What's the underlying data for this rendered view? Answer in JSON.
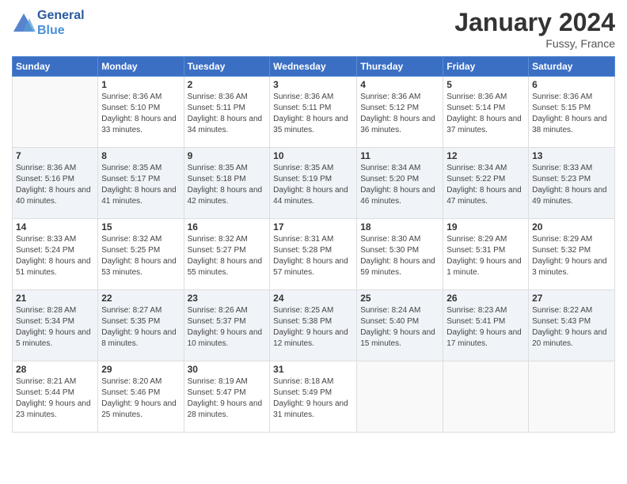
{
  "header": {
    "logo_line1": "General",
    "logo_line2": "Blue",
    "title": "January 2024",
    "location": "Fussy, France"
  },
  "columns": [
    "Sunday",
    "Monday",
    "Tuesday",
    "Wednesday",
    "Thursday",
    "Friday",
    "Saturday"
  ],
  "weeks": [
    [
      {
        "day": "",
        "sunrise": "",
        "sunset": "",
        "daylight": ""
      },
      {
        "day": "1",
        "sunrise": "Sunrise: 8:36 AM",
        "sunset": "Sunset: 5:10 PM",
        "daylight": "Daylight: 8 hours and 33 minutes."
      },
      {
        "day": "2",
        "sunrise": "Sunrise: 8:36 AM",
        "sunset": "Sunset: 5:11 PM",
        "daylight": "Daylight: 8 hours and 34 minutes."
      },
      {
        "day": "3",
        "sunrise": "Sunrise: 8:36 AM",
        "sunset": "Sunset: 5:11 PM",
        "daylight": "Daylight: 8 hours and 35 minutes."
      },
      {
        "day": "4",
        "sunrise": "Sunrise: 8:36 AM",
        "sunset": "Sunset: 5:12 PM",
        "daylight": "Daylight: 8 hours and 36 minutes."
      },
      {
        "day": "5",
        "sunrise": "Sunrise: 8:36 AM",
        "sunset": "Sunset: 5:14 PM",
        "daylight": "Daylight: 8 hours and 37 minutes."
      },
      {
        "day": "6",
        "sunrise": "Sunrise: 8:36 AM",
        "sunset": "Sunset: 5:15 PM",
        "daylight": "Daylight: 8 hours and 38 minutes."
      }
    ],
    [
      {
        "day": "7",
        "sunrise": "Sunrise: 8:36 AM",
        "sunset": "Sunset: 5:16 PM",
        "daylight": "Daylight: 8 hours and 40 minutes."
      },
      {
        "day": "8",
        "sunrise": "Sunrise: 8:35 AM",
        "sunset": "Sunset: 5:17 PM",
        "daylight": "Daylight: 8 hours and 41 minutes."
      },
      {
        "day": "9",
        "sunrise": "Sunrise: 8:35 AM",
        "sunset": "Sunset: 5:18 PM",
        "daylight": "Daylight: 8 hours and 42 minutes."
      },
      {
        "day": "10",
        "sunrise": "Sunrise: 8:35 AM",
        "sunset": "Sunset: 5:19 PM",
        "daylight": "Daylight: 8 hours and 44 minutes."
      },
      {
        "day": "11",
        "sunrise": "Sunrise: 8:34 AM",
        "sunset": "Sunset: 5:20 PM",
        "daylight": "Daylight: 8 hours and 46 minutes."
      },
      {
        "day": "12",
        "sunrise": "Sunrise: 8:34 AM",
        "sunset": "Sunset: 5:22 PM",
        "daylight": "Daylight: 8 hours and 47 minutes."
      },
      {
        "day": "13",
        "sunrise": "Sunrise: 8:33 AM",
        "sunset": "Sunset: 5:23 PM",
        "daylight": "Daylight: 8 hours and 49 minutes."
      }
    ],
    [
      {
        "day": "14",
        "sunrise": "Sunrise: 8:33 AM",
        "sunset": "Sunset: 5:24 PM",
        "daylight": "Daylight: 8 hours and 51 minutes."
      },
      {
        "day": "15",
        "sunrise": "Sunrise: 8:32 AM",
        "sunset": "Sunset: 5:25 PM",
        "daylight": "Daylight: 8 hours and 53 minutes."
      },
      {
        "day": "16",
        "sunrise": "Sunrise: 8:32 AM",
        "sunset": "Sunset: 5:27 PM",
        "daylight": "Daylight: 8 hours and 55 minutes."
      },
      {
        "day": "17",
        "sunrise": "Sunrise: 8:31 AM",
        "sunset": "Sunset: 5:28 PM",
        "daylight": "Daylight: 8 hours and 57 minutes."
      },
      {
        "day": "18",
        "sunrise": "Sunrise: 8:30 AM",
        "sunset": "Sunset: 5:30 PM",
        "daylight": "Daylight: 8 hours and 59 minutes."
      },
      {
        "day": "19",
        "sunrise": "Sunrise: 8:29 AM",
        "sunset": "Sunset: 5:31 PM",
        "daylight": "Daylight: 9 hours and 1 minute."
      },
      {
        "day": "20",
        "sunrise": "Sunrise: 8:29 AM",
        "sunset": "Sunset: 5:32 PM",
        "daylight": "Daylight: 9 hours and 3 minutes."
      }
    ],
    [
      {
        "day": "21",
        "sunrise": "Sunrise: 8:28 AM",
        "sunset": "Sunset: 5:34 PM",
        "daylight": "Daylight: 9 hours and 5 minutes."
      },
      {
        "day": "22",
        "sunrise": "Sunrise: 8:27 AM",
        "sunset": "Sunset: 5:35 PM",
        "daylight": "Daylight: 9 hours and 8 minutes."
      },
      {
        "day": "23",
        "sunrise": "Sunrise: 8:26 AM",
        "sunset": "Sunset: 5:37 PM",
        "daylight": "Daylight: 9 hours and 10 minutes."
      },
      {
        "day": "24",
        "sunrise": "Sunrise: 8:25 AM",
        "sunset": "Sunset: 5:38 PM",
        "daylight": "Daylight: 9 hours and 12 minutes."
      },
      {
        "day": "25",
        "sunrise": "Sunrise: 8:24 AM",
        "sunset": "Sunset: 5:40 PM",
        "daylight": "Daylight: 9 hours and 15 minutes."
      },
      {
        "day": "26",
        "sunrise": "Sunrise: 8:23 AM",
        "sunset": "Sunset: 5:41 PM",
        "daylight": "Daylight: 9 hours and 17 minutes."
      },
      {
        "day": "27",
        "sunrise": "Sunrise: 8:22 AM",
        "sunset": "Sunset: 5:43 PM",
        "daylight": "Daylight: 9 hours and 20 minutes."
      }
    ],
    [
      {
        "day": "28",
        "sunrise": "Sunrise: 8:21 AM",
        "sunset": "Sunset: 5:44 PM",
        "daylight": "Daylight: 9 hours and 23 minutes."
      },
      {
        "day": "29",
        "sunrise": "Sunrise: 8:20 AM",
        "sunset": "Sunset: 5:46 PM",
        "daylight": "Daylight: 9 hours and 25 minutes."
      },
      {
        "day": "30",
        "sunrise": "Sunrise: 8:19 AM",
        "sunset": "Sunset: 5:47 PM",
        "daylight": "Daylight: 9 hours and 28 minutes."
      },
      {
        "day": "31",
        "sunrise": "Sunrise: 8:18 AM",
        "sunset": "Sunset: 5:49 PM",
        "daylight": "Daylight: 9 hours and 31 minutes."
      },
      {
        "day": "",
        "sunrise": "",
        "sunset": "",
        "daylight": ""
      },
      {
        "day": "",
        "sunrise": "",
        "sunset": "",
        "daylight": ""
      },
      {
        "day": "",
        "sunrise": "",
        "sunset": "",
        "daylight": ""
      }
    ]
  ]
}
